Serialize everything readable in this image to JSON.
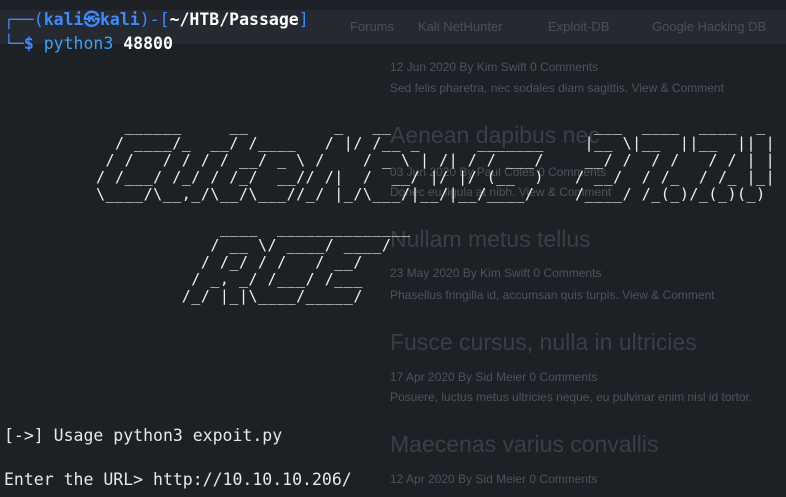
{
  "browser_ghost": {
    "bookmarks": [
      "Forums",
      "Kali NetHunter",
      "Exploit-DB",
      "Google Hacking DB"
    ],
    "posts": [
      {
        "title": "",
        "meta": "12 Jun 2020 By Kim Swift 0 Comments",
        "summary": "Sed felis pharetra, nec sodales diam sagittis. View & Comment"
      },
      {
        "title": "Aenean dapibus nec",
        "meta": "03 Jun 2020 By Paul Coles 0 Comments",
        "summary": "Donec eu ligula at nibh. View & Comment"
      },
      {
        "title": "Nullam metus tellus",
        "meta": "23 May 2020 By Kim Swift 0 Comments",
        "summary": "Phasellus fringilla id, accumsan quis turpis. View & Comment"
      },
      {
        "title": "Fusce cursus, nulla in ultricies",
        "meta": "17 Apr 2020 By Sid Meier 0 Comments",
        "summary": "Posuere, luctus metus ultricies neque, eu pulvinar enim nisl id tortor."
      },
      {
        "title": "Maecenas varius convallis",
        "meta": "12 Apr 2020 By Sid Meier 0 Comments",
        "summary": ""
      }
    ]
  },
  "terminal": {
    "prompt_top_left": "┌──(",
    "user": "kali",
    "at_symbol": "㉿",
    "host": "kali",
    "prompt_mid": ")-[",
    "path": "~/HTB/Passage",
    "prompt_end": "]",
    "prompt_bottom": "└─",
    "dollar": "$ ",
    "command": "python3",
    "argument": " 48800",
    "ascii_banner": "   ______     __         _   __\n  / ____/_  __/ /____   / |/ /__ _      _______\n / /   / / / / __/ _ \\ /    / _ \\ | /| / / ___/\n/ /___/ /_/ / /_/  __// /|  /  __/ |/ |/ (__  )\n\\____/\\__,_/\\__/\\___//_/ |_/\\___/|__/|__/____/\n\n             ____  ______________\n            / __ \\/ ____/ ____/\n           / /_/ / /   / __/\n          / _, _/ /___/ /___\n         /_/ |_|\\____/_____/",
    "ascii_version": "  ___  ____  ____  _\n |__ \\|__  ||__  || |\n __/ /  / /   / / | |\n/ __/  / /_  / /_ |_|\n/____/ /_(_)/_(_)(_)",
    "usage_line": "[->] Usage python3 expoit.py",
    "url_prompt": "Enter the URL> http://10.10.10.206/"
  }
}
